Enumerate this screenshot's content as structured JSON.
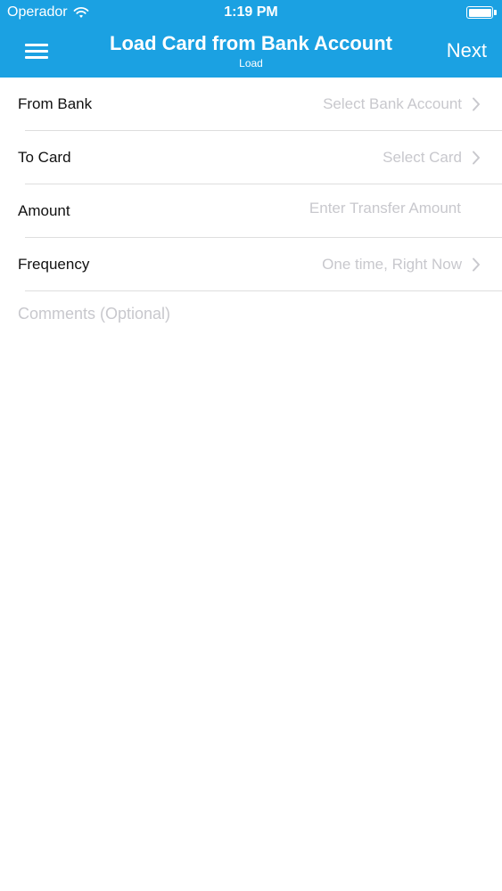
{
  "status_bar": {
    "carrier": "Operador",
    "time": "1:19 PM",
    "wifi_icon": "wifi-icon",
    "battery_icon": "battery-icon"
  },
  "nav": {
    "title": "Load Card from Bank Account",
    "subtitle": "Load",
    "menu_icon": "hamburger-menu-icon",
    "next_label": "Next",
    "background_color": "#1ba1e2"
  },
  "form": {
    "rows": [
      {
        "label": "From Bank",
        "value": "Select Bank Account",
        "chevron": true
      },
      {
        "label": "To Card",
        "value": "Select Card",
        "chevron": true
      },
      {
        "label": "Amount",
        "placeholder": "Enter Transfer Amount",
        "chevron": false
      },
      {
        "label": "Frequency",
        "value": "One time, Right Now",
        "chevron": true
      }
    ],
    "comments_placeholder": "Comments (Optional)"
  }
}
